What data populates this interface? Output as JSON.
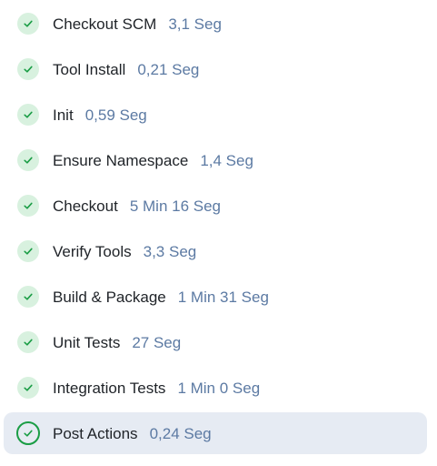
{
  "colors": {
    "success": "#1a9d45",
    "success_bg": "#d8f1df",
    "selected_bg": "#e6ebf3",
    "duration_text": "#5c7aa3",
    "name_text": "#1f2328"
  },
  "steps": [
    {
      "name": "Checkout SCM",
      "duration": "3,1 Seg",
      "status": "success",
      "icon": "check-icon"
    },
    {
      "name": "Tool Install",
      "duration": "0,21 Seg",
      "status": "success",
      "icon": "check-icon"
    },
    {
      "name": "Init",
      "duration": "0,59 Seg",
      "status": "success",
      "icon": "check-icon"
    },
    {
      "name": "Ensure Namespace",
      "duration": "1,4 Seg",
      "status": "success",
      "icon": "check-icon"
    },
    {
      "name": "Checkout",
      "duration": "5 Min 16 Seg",
      "status": "success",
      "icon": "check-icon"
    },
    {
      "name": "Verify Tools",
      "duration": "3,3 Seg",
      "status": "success",
      "icon": "check-icon"
    },
    {
      "name": "Build & Package",
      "duration": "1 Min 31 Seg",
      "status": "success",
      "icon": "check-icon"
    },
    {
      "name": "Unit Tests",
      "duration": "27 Seg",
      "status": "success",
      "icon": "check-icon"
    },
    {
      "name": "Integration Tests",
      "duration": "1 Min 0 Seg",
      "status": "success",
      "icon": "check-icon"
    },
    {
      "name": "Post Actions",
      "duration": "0,24 Seg",
      "status": "success",
      "icon": "check-icon",
      "selected": true
    }
  ]
}
